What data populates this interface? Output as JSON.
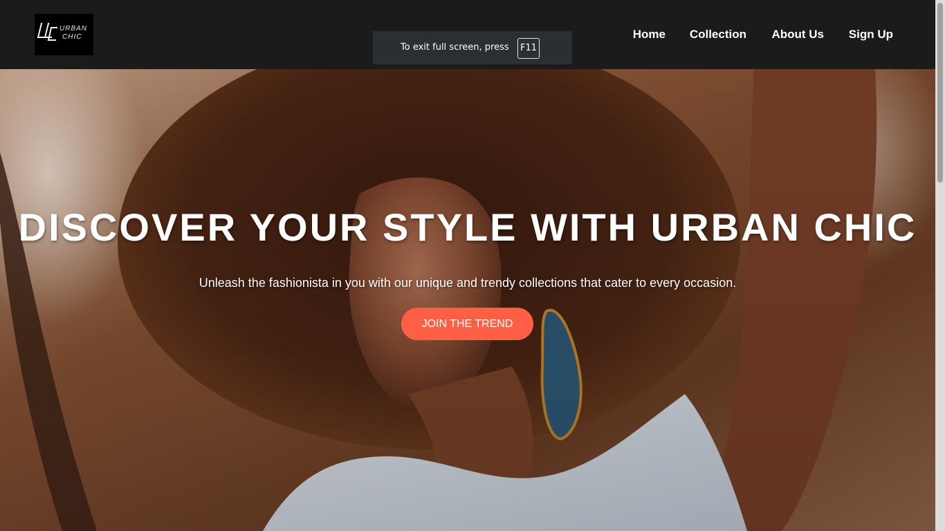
{
  "logo": {
    "line1": "URBAN",
    "line2": "CHIC"
  },
  "nav": {
    "items": [
      {
        "label": "Home"
      },
      {
        "label": "Collection"
      },
      {
        "label": "About Us"
      },
      {
        "label": "Sign Up"
      }
    ]
  },
  "fullscreen_notice": {
    "text": "To exit full screen, press",
    "key": "F11"
  },
  "hero": {
    "title": "DISCOVER YOUR STYLE WITH URBAN CHIC",
    "subtitle": "Unleash the fashionista in you with our unique and trendy collections that cater to every occasion.",
    "cta_label": "JOIN THE TREND"
  },
  "colors": {
    "header_bg": "#1b1b1c",
    "cta_bg": "#ff5f45",
    "text": "#ffffff"
  }
}
